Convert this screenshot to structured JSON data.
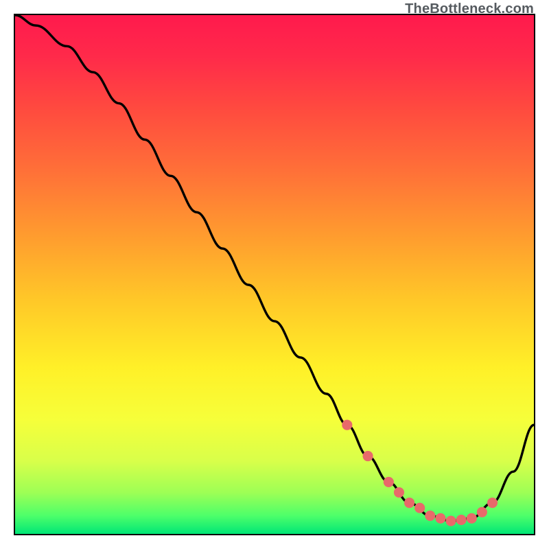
{
  "watermark": "TheBottleneck.com",
  "chart_data": {
    "type": "line",
    "title": "",
    "xlabel": "",
    "ylabel": "",
    "xlim": [
      0,
      100
    ],
    "ylim": [
      0,
      100
    ],
    "series": [
      {
        "name": "curve",
        "x": [
          0,
          4,
          10,
          15,
          20,
          25,
          30,
          35,
          40,
          45,
          50,
          55,
          60,
          64,
          68,
          72,
          76,
          80,
          84,
          88,
          92,
          96,
          100
        ],
        "values": [
          100,
          98,
          94,
          89,
          83,
          76,
          69,
          62,
          55,
          48,
          41,
          34,
          27,
          21,
          15,
          10,
          6,
          3.5,
          2.5,
          3,
          6,
          12,
          21
        ]
      },
      {
        "name": "dots",
        "x": [
          64,
          68,
          72,
          74,
          76,
          78,
          80,
          82,
          84,
          86,
          88,
          90,
          92
        ],
        "values": [
          21,
          15,
          10,
          8,
          6,
          5,
          3.5,
          3,
          2.5,
          2.7,
          3,
          4.2,
          6
        ]
      }
    ],
    "gradient_stops": [
      {
        "t": 0.0,
        "color": "#ff1a4d"
      },
      {
        "t": 0.08,
        "color": "#ff2a4a"
      },
      {
        "t": 0.18,
        "color": "#ff4a3f"
      },
      {
        "t": 0.3,
        "color": "#ff7038"
      },
      {
        "t": 0.42,
        "color": "#ff9a2f"
      },
      {
        "t": 0.55,
        "color": "#ffc828"
      },
      {
        "t": 0.68,
        "color": "#fff028"
      },
      {
        "t": 0.78,
        "color": "#f6ff3a"
      },
      {
        "t": 0.86,
        "color": "#d8ff4a"
      },
      {
        "t": 0.92,
        "color": "#9eff55"
      },
      {
        "t": 0.965,
        "color": "#4dff6a"
      },
      {
        "t": 1.0,
        "color": "#00e676"
      }
    ],
    "dot_color": "#e86a6a",
    "line_color": "#000000"
  }
}
